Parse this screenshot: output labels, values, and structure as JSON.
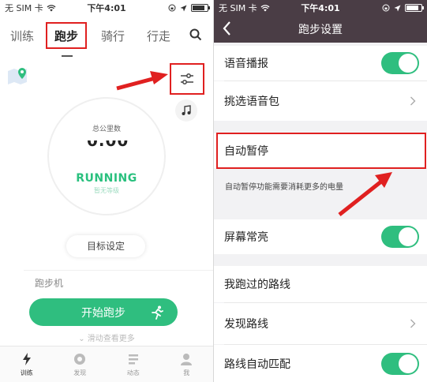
{
  "left": {
    "status": {
      "carrier": "无 SIM 卡",
      "time": "下午4:01"
    },
    "tabs": [
      "训练",
      "跑步",
      "骑行",
      "行走"
    ],
    "ring": {
      "title": "总公里数",
      "value": "0.00",
      "state": "RUNNING",
      "state_sub": "暂无等级"
    },
    "goal_button": "目标设定",
    "treadmill": "跑步机",
    "start_button": "开始跑步",
    "slide_hint": "滑动查看更多",
    "bottom_nav": [
      "训练",
      "发现",
      "动态",
      "我"
    ]
  },
  "right": {
    "status": {
      "carrier": "无 SIM 卡",
      "time": "下午4:01"
    },
    "title": "跑步设置",
    "rows": {
      "voice": "语音播报",
      "voice_pack": "挑选语音包",
      "auto_pause": "自动暂停",
      "auto_pause_hint": "自动暂停功能需要消耗更多的电量",
      "screen_on": "屏幕常亮",
      "my_routes": "我跑过的路线",
      "discover_routes": "发现路线",
      "auto_match": "路线自动匹配"
    },
    "toggles": {
      "voice": true,
      "screen_on": true,
      "auto_match": true
    }
  },
  "colors": {
    "accent_green": "#2fbe7f",
    "highlight_red": "#e02020",
    "nav_bar": "#4a3d45"
  }
}
